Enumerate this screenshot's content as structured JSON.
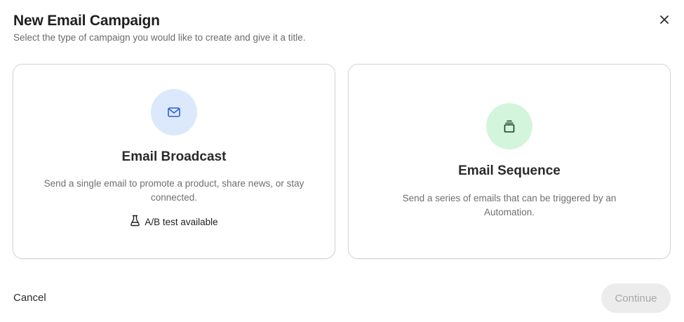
{
  "modal": {
    "title": "New Email Campaign",
    "subtitle": "Select the type of campaign you would like to create and give it a title."
  },
  "cards": {
    "broadcast": {
      "title": "Email Broadcast",
      "description": "Send a single email to promote a product, share news, or stay connected.",
      "badge": "A/B test available",
      "icon": "mail-icon",
      "accent": "#dce8fb"
    },
    "sequence": {
      "title": "Email Sequence",
      "description": "Send a series of emails that can be triggered by an Automation.",
      "icon": "stack-icon",
      "accent": "#d3f5dc"
    }
  },
  "footer": {
    "cancel_label": "Cancel",
    "continue_label": "Continue"
  },
  "colors": {
    "broadcast_icon": "#2b5fd9",
    "sequence_icon": "#1f3d2a",
    "disabled_bg": "#ececec",
    "disabled_text": "#a8a8a8"
  }
}
